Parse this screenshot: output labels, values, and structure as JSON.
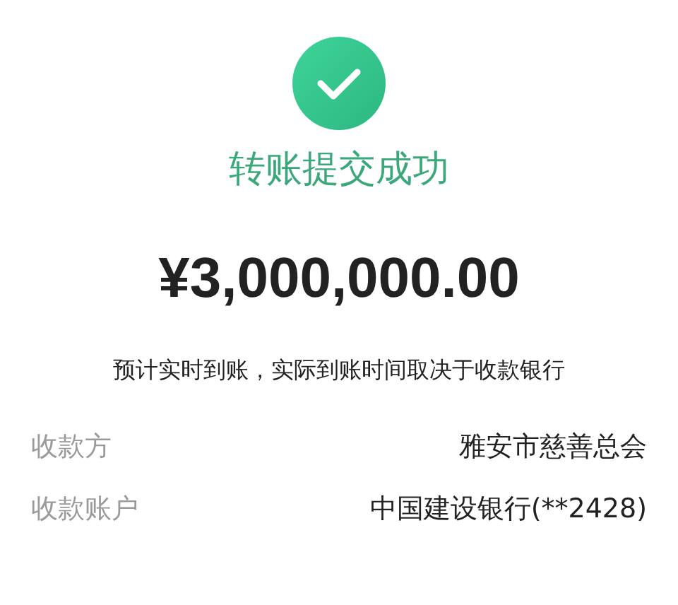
{
  "status": {
    "kind": "success",
    "title": "转账提交成功"
  },
  "amount": "¥3,000,000.00",
  "note": "预计实时到账，实际到账时间取决于收款银行",
  "details": [
    {
      "label": "收款方",
      "value": "雅安市慈善总会"
    },
    {
      "label": "收款账户",
      "value": "中国建设银行(**2428)"
    }
  ]
}
